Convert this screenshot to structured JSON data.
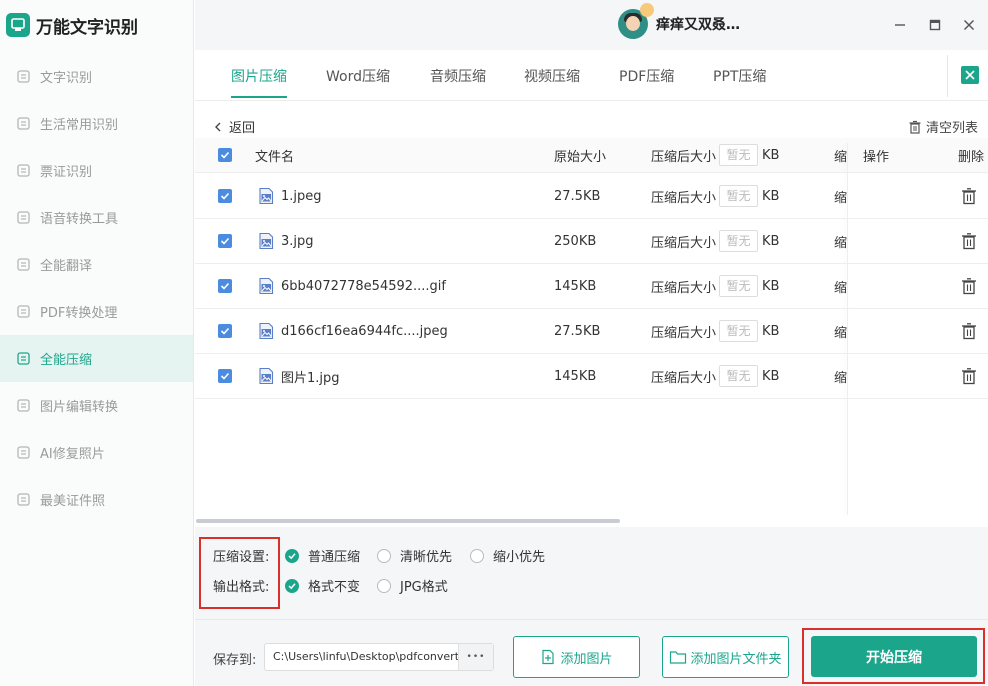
{
  "app": {
    "title": "万能文字识别"
  },
  "sidebar": {
    "items": [
      {
        "label": "文字识别",
        "icon": "text-recognition-icon",
        "active": false
      },
      {
        "label": "生活常用识别",
        "icon": "life-recognition-icon",
        "active": false
      },
      {
        "label": "票证识别",
        "icon": "ticket-recognition-icon",
        "active": false
      },
      {
        "label": "语音转换工具",
        "icon": "voice-convert-icon",
        "active": false
      },
      {
        "label": "全能翻译",
        "icon": "translate-icon",
        "active": false
      },
      {
        "label": "PDF转换处理",
        "icon": "pdf-icon",
        "active": false
      },
      {
        "label": "全能压缩",
        "icon": "compress-icon",
        "active": true
      },
      {
        "label": "图片编辑转换",
        "icon": "image-edit-icon",
        "active": false
      },
      {
        "label": "AI修复照片",
        "icon": "ai-photo-icon",
        "active": false
      },
      {
        "label": "最美证件照",
        "icon": "id-photo-icon",
        "active": false
      }
    ]
  },
  "titlebar": {
    "username": "痒痒又双叒…"
  },
  "tabs": [
    "图片压缩",
    "Word压缩",
    "音频压缩",
    "视频压缩",
    "PDF压缩",
    "PPT压缩"
  ],
  "list": {
    "back_label": "返回",
    "clear_label": "清空列表",
    "headers": {
      "name": "文件名",
      "original_size": "原始大小",
      "target_size": "压缩后大小",
      "target_placeholder": "暂无",
      "unit": "KB",
      "compressed": "缩",
      "action": "操作",
      "delete": "删除"
    },
    "rows": [
      {
        "name": "1.jpeg",
        "size": "27.5KB",
        "placeholder": "暂无",
        "unit": "KB",
        "compressed": "缩"
      },
      {
        "name": "3.jpg",
        "size": "250KB",
        "placeholder": "暂无",
        "unit": "KB",
        "compressed": "缩"
      },
      {
        "name": "6bb4072778e54592....gif",
        "size": "145KB",
        "placeholder": "暂无",
        "unit": "KB",
        "compressed": "缩"
      },
      {
        "name": "d166cf16ea6944fc....jpeg",
        "size": "27.5KB",
        "placeholder": "暂无",
        "unit": "KB",
        "compressed": "缩"
      },
      {
        "name": "图片1.jpg",
        "size": "145KB",
        "placeholder": "暂无",
        "unit": "KB",
        "compressed": "缩"
      }
    ]
  },
  "settings": {
    "compress_label": "压缩设置:",
    "format_label": "输出格式:",
    "compress_options": [
      {
        "label": "普通压缩",
        "selected": true
      },
      {
        "label": "清晰优先",
        "selected": false
      },
      {
        "label": "缩小优先",
        "selected": false
      }
    ],
    "format_options": [
      {
        "label": "格式不变",
        "selected": true
      },
      {
        "label": "JPG格式",
        "selected": false
      }
    ]
  },
  "bottom": {
    "save_label": "保存到:",
    "save_path": "C:\\Users\\linfu\\Desktop\\pdfconvert",
    "browse_label": "•••",
    "add_image_label": "添加图片",
    "add_folder_label": "添加图片文件夹",
    "start_label": "开始压缩"
  },
  "colors": {
    "accent": "#1ba68c",
    "checkbox": "#4c8ce0",
    "highlight": "#d9302c"
  }
}
